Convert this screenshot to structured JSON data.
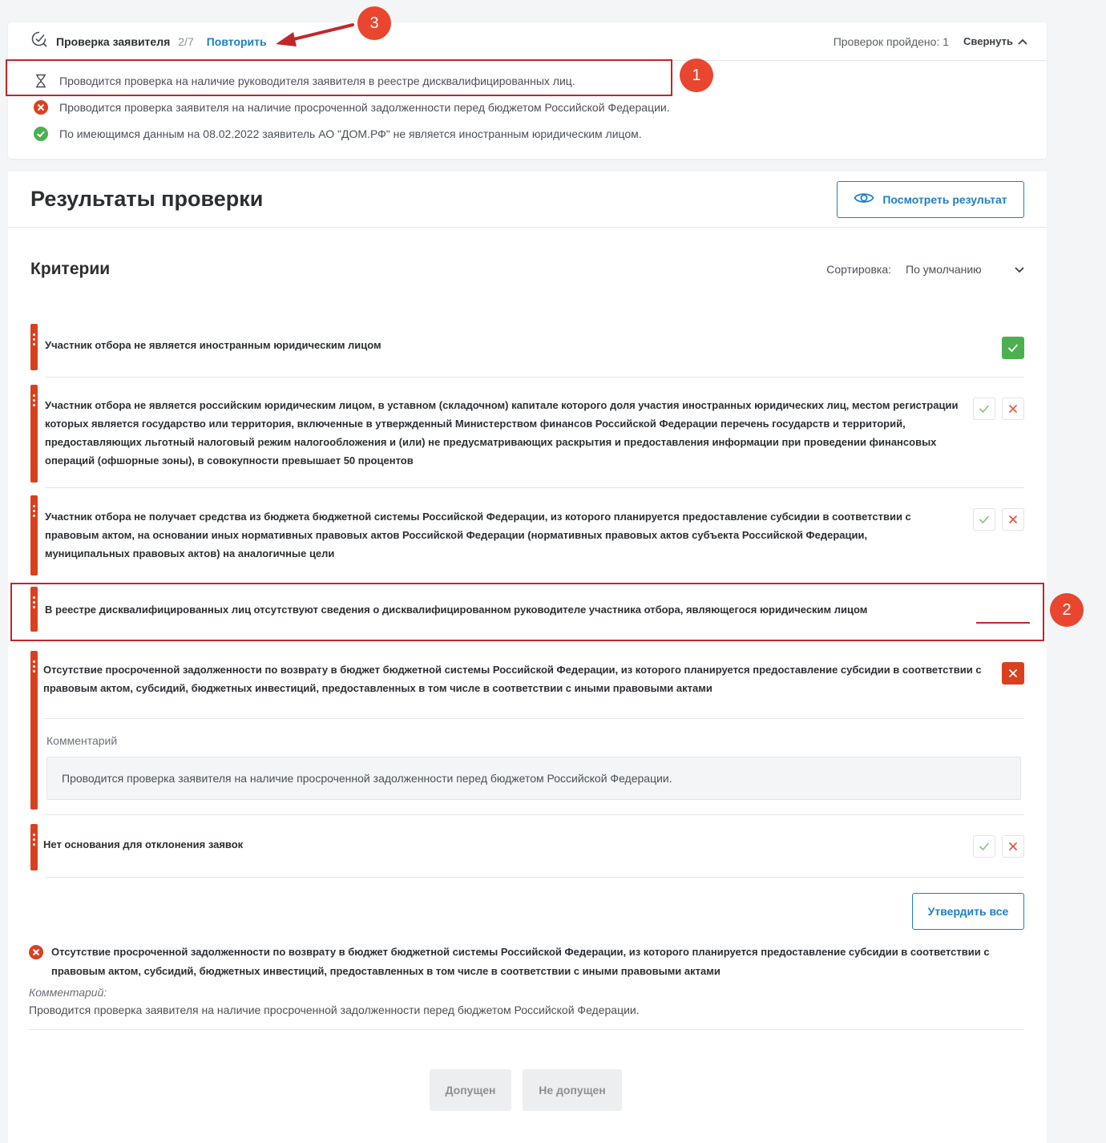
{
  "status": {
    "title": "Проверка заявителя",
    "count": "2/7",
    "repeat": "Повторить",
    "passed": "Проверок пройдено: 1",
    "collapse": "Свернуть",
    "items": [
      {
        "icon": "hourglass-icon",
        "text": "Проводится проверка на наличие руководителя заявителя в реестре дисквалифицированных лиц."
      },
      {
        "icon": "error-circle-icon",
        "text": "Проводится проверка заявителя на наличие просроченной задолженности перед бюджетом Российской Федерации."
      },
      {
        "icon": "success-circle-icon",
        "text": "По имеющимся данным на 08.02.2022 заявитель АО \"ДОМ.РФ\" не является иностранным юридическим лицом."
      }
    ]
  },
  "main": {
    "title": "Результаты проверки",
    "view_result": "Посмотреть результат"
  },
  "criteria": {
    "title": "Критерии",
    "sort_label": "Сортировка:",
    "sort_value": "По умолчанию",
    "items": [
      {
        "text": "Участник отбора не является иностранным юридическим лицом"
      },
      {
        "text": "Участник отбора не является российским юридическим лицом, в уставном (складочном) капитале которого доля участия иностранных юридических лиц, местом регистрации которых является государство или территория, включенные в утвержденный Министерством финансов Российской Федерации перечень государств и территорий, предоставляющих льготный налоговый режим налогообложения и (или) не предусматривающих раскрытия и предоставления информации при проведении финансовых операций (офшорные зоны), в совокупности превышает 50 процентов"
      },
      {
        "text": "Участник отбора не получает средства из бюджета бюджетной системы Российской Федерации, из которого планируется предоставление субсидии в соответствии с правовым актом, на основании иных нормативных правовых актов Российской Федерации (нормативных правовых актов субъекта Российской Федерации, муниципальных правовых актов) на аналогичные цели"
      },
      {
        "text": "В реестре дисквалифицированных лиц отсутствуют сведения о дисквалифицированном руководителе участника отбора, являющегося юридическим лицом"
      },
      {
        "text": "Отсутствие просроченной задолженности по возврату в бюджет бюджетной системы Российской Федерации, из которого планируется предоставление субсидии в соответствии с правовым актом, субсидий, бюджетных инвестиций, предоставленных в том числе в соответствии с иными правовыми актами"
      },
      {
        "text": "Нет основания для отклонения заявок"
      }
    ],
    "comment_label": "Комментарий",
    "comment_text": "Проводится проверка заявителя на наличие просроченной задолженности перед бюджетом Российской Федерации."
  },
  "approve_all": "Утвердить все",
  "summary": {
    "text": "Отсутствие просроченной задолженности по возврату в бюджет бюджетной системы Российской Федерации, из которого планируется предоставление субсидии в соответствии с правовым актом, субсидий, бюджетных инвестиций, предоставленных в том числе в соответствии с иными правовыми актами",
    "comment_label": "Комментарий:",
    "comment_text": "Проводится проверка заявителя на наличие просроченной задолженности перед бюджетом Российской Федерации."
  },
  "buttons": {
    "admitted": "Допущен",
    "not_admitted": "Не допущен"
  },
  "annotations": [
    "1",
    "2",
    "3"
  ],
  "colors": {
    "accent": "#1b7fc4",
    "critical": "#d9411e",
    "success": "#4caf50",
    "annotation": "#e8462f"
  }
}
